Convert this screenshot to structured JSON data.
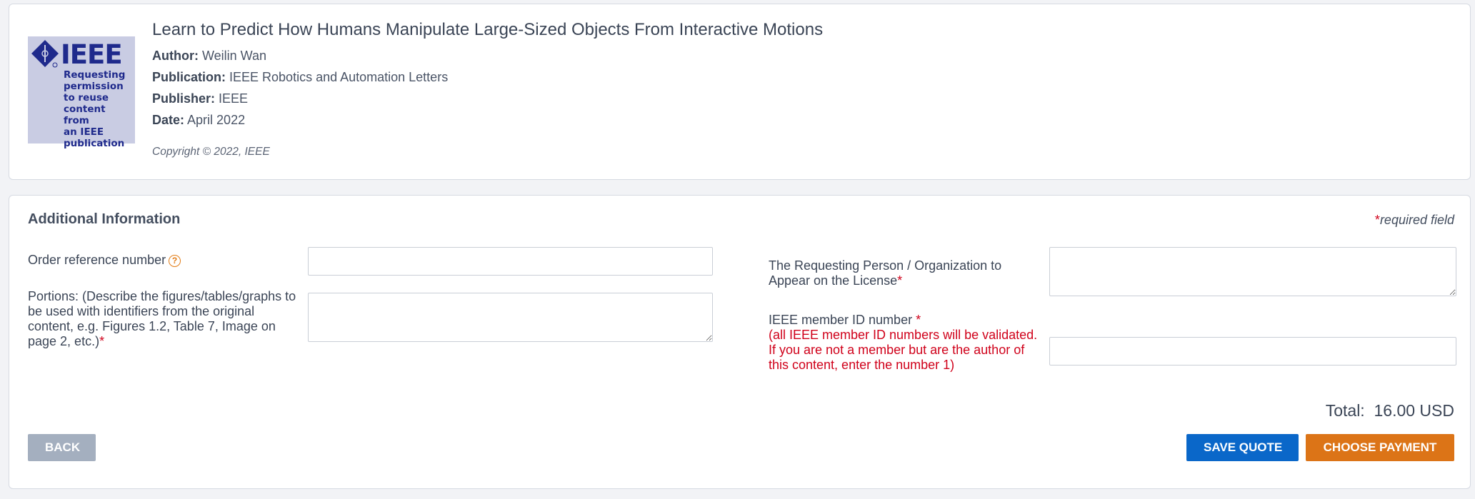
{
  "header": {
    "logo": {
      "word": "IEEE",
      "caption": "Requesting\npermission\nto reuse\ncontent from\nan IEEE\npublication"
    },
    "title": "Learn to Predict How Humans Manipulate Large-Sized Objects From Interactive Motions",
    "author_label": "Author:",
    "author": "Weilin Wan",
    "publication_label": "Publication:",
    "publication": "IEEE Robotics and Automation Letters",
    "publisher_label": "Publisher:",
    "publisher": "IEEE",
    "date_label": "Date:",
    "date": "April 2022",
    "copyright": "Copyright © 2022, IEEE"
  },
  "form": {
    "section_title": "Additional Information",
    "required_mark": "*",
    "required_note": "required field",
    "order_ref_label": "Order reference number",
    "order_ref_help_icon": "question-circle-icon",
    "order_ref_value": "",
    "portions_label": "Portions: (Describe the figures/tables/graphs to be used with identifiers from the original content, e.g. Figures 1.2, Table 7, Image on page 2, etc.)",
    "portions_value": "",
    "requester_label": "The Requesting Person / Organization to Appear on the License",
    "requester_value": "",
    "ieee_id_label": "IEEE member ID number ",
    "ieee_id_note": "(all IEEE member ID numbers will be validated. If you are not a member but are the author of this content, enter the number 1)",
    "ieee_id_value": ""
  },
  "total": {
    "label": "Total:",
    "value": "16.00 USD"
  },
  "buttons": {
    "back": "BACK",
    "save_quote": "SAVE QUOTE",
    "choose_payment": "CHOOSE PAYMENT"
  },
  "colors": {
    "primary": "#0a67c9",
    "accent": "#dc7417",
    "required": "#d0021b",
    "back": "#a4afbf"
  }
}
